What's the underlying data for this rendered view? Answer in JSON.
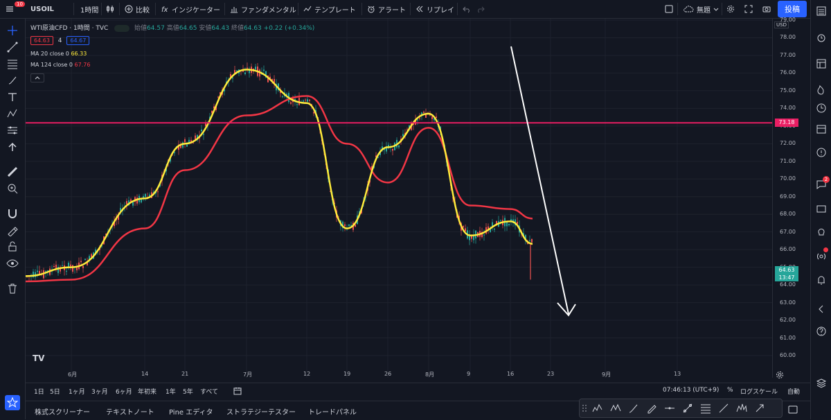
{
  "topbar": {
    "symbol": "USOIL",
    "interval": "1時間",
    "compare": "比較",
    "indicators": "インジケーター",
    "fundamentals": "ファンダメンタル",
    "templates": "テンプレート",
    "alert": "アラート",
    "replay": "リプレイ",
    "layout_name": "無題",
    "post_button": "投稿",
    "menu_badge": "10"
  },
  "legend": {
    "title": "WTI原油CFD · 1時間 · TVC",
    "open_label": "始値",
    "open": "64.57",
    "high_label": "高値",
    "high": "64.65",
    "low_label": "安値",
    "low": "64.43",
    "close_label": "終値",
    "close": "64.63",
    "change": "+0.22 (+0.34%)",
    "bid": "64.63",
    "spread": "4",
    "ask": "64.67",
    "ma20_label": "MA 20 close 0",
    "ma20_value": "66.33",
    "ma124_label": "MA 124 close 0",
    "ma124_value": "67.76"
  },
  "price_axis": {
    "currency": "USD",
    "labels": [
      "79.00",
      "78.00",
      "77.00",
      "76.00",
      "75.00",
      "74.00",
      "73.00",
      "72.00",
      "71.00",
      "70.00",
      "69.00",
      "68.00",
      "67.00",
      "66.00",
      "65.00",
      "64.00",
      "63.00",
      "62.00",
      "61.00",
      "60.00"
    ],
    "hline_value": "73.18",
    "last_price": "64.63",
    "countdown": "13:47"
  },
  "time_axis": [
    "6月",
    "14",
    "21",
    "7月",
    "12",
    "19",
    "26",
    "8月",
    "9",
    "16",
    "23",
    "9月",
    "13"
  ],
  "rangebar": {
    "ranges": [
      "1日",
      "5日",
      "1ヶ月",
      "3ヶ月",
      "6ヶ月",
      "年初来",
      "1年",
      "5年",
      "すべて"
    ],
    "clock": "07:46:13 (UTC+9)",
    "percent": "%",
    "log": "ログスケール",
    "auto": "自動"
  },
  "bottom_tabs": [
    "株式スクリーナー",
    "テキストノート",
    "Pine エディタ",
    "ストラテジーテスター",
    "トレードパネル"
  ],
  "right_badge": "2",
  "colors": {
    "background": "#131722",
    "ma20": "#ffeb3b",
    "ma124": "#f23645",
    "hline": "#e91e63",
    "last_price": "#26a69a",
    "accent": "#2962ff"
  },
  "chart_data": {
    "type": "line",
    "symbol": "WTI原油CFD",
    "interval": "1時間",
    "ylim": [
      60,
      79
    ],
    "x": [
      "6月",
      "14",
      "21",
      "7月",
      "12",
      "19",
      "26",
      "8月",
      "9",
      "16"
    ],
    "series": [
      {
        "name": "MA 20 close 0",
        "values": [
          65.0,
          68.9,
          72.0,
          76.2,
          74.3,
          67.2,
          71.8,
          73.7,
          66.8,
          67.6
        ]
      },
      {
        "name": "MA 124 close 0",
        "values": [
          64.3,
          67.2,
          70.5,
          73.6,
          74.7,
          72.0,
          69.8,
          72.9,
          68.5,
          68.3
        ]
      }
    ],
    "horizontal_line": 73.18,
    "last_price": 64.63
  }
}
